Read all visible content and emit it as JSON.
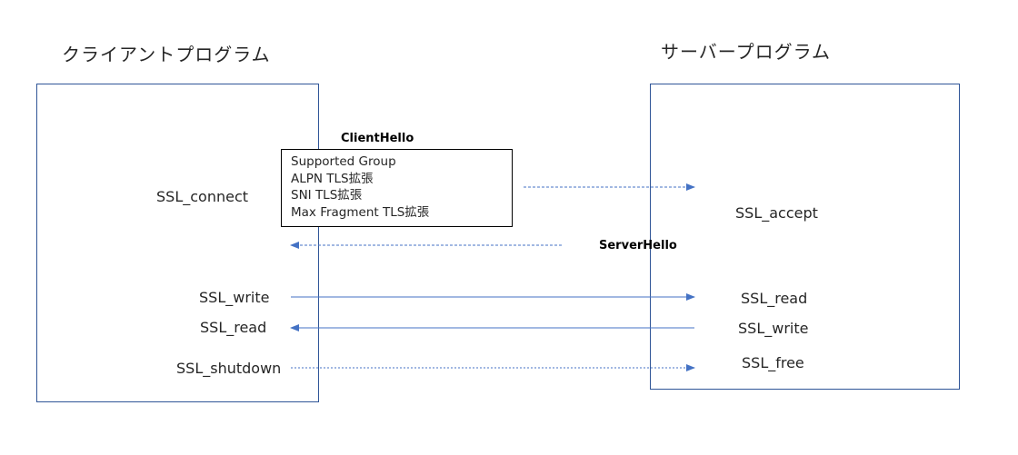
{
  "client": {
    "title": "クライアントプログラム",
    "functions": {
      "connect": "SSL_connect",
      "write": "SSL_write",
      "read": "SSL_read",
      "shutdown": "SSL_shutdown"
    }
  },
  "server": {
    "title": "サーバープログラム",
    "functions": {
      "accept": "SSL_accept",
      "read": "SSL_read",
      "write": "SSL_write",
      "free": "SSL_free"
    }
  },
  "client_hello": {
    "title": "ClientHello",
    "extensions": [
      "Supported Group",
      "ALPN TLS拡張",
      "SNI TLS拡張",
      "Max Fragment TLS拡張"
    ]
  },
  "server_hello": {
    "title": "ServerHello"
  },
  "colors": {
    "box_border": "#2f5597",
    "arrow": "#4472c4"
  }
}
